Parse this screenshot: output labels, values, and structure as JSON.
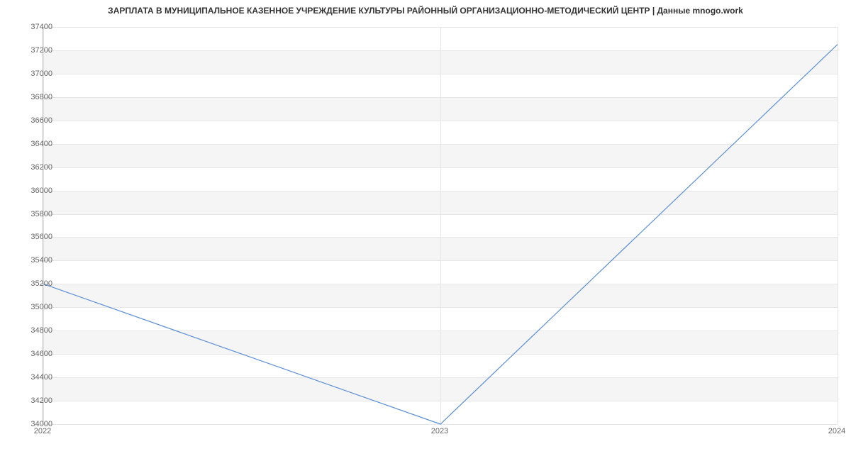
{
  "chart_data": {
    "type": "line",
    "title": "ЗАРПЛАТА В МУНИЦИПАЛЬНОЕ КАЗЕННОЕ УЧРЕЖДЕНИЕ КУЛЬТУРЫ РАЙОННЫЙ ОРГАНИЗАЦИОННО-МЕТОДИЧЕСКИЙ ЦЕНТР | Данные mnogo.work",
    "xlabel": "",
    "ylabel": "",
    "categories": [
      "2022",
      "2023",
      "2024"
    ],
    "x": [
      2022,
      2023,
      2024
    ],
    "values": [
      35200,
      34000,
      37250
    ],
    "ylim": [
      34000,
      37400
    ],
    "yticks": [
      34000,
      34200,
      34400,
      34600,
      34800,
      35000,
      35200,
      35400,
      35600,
      35800,
      36000,
      36200,
      36400,
      36600,
      36800,
      37000,
      37200,
      37400
    ],
    "line_color": "#5b8fd6",
    "band_color": "#f5f5f5"
  }
}
